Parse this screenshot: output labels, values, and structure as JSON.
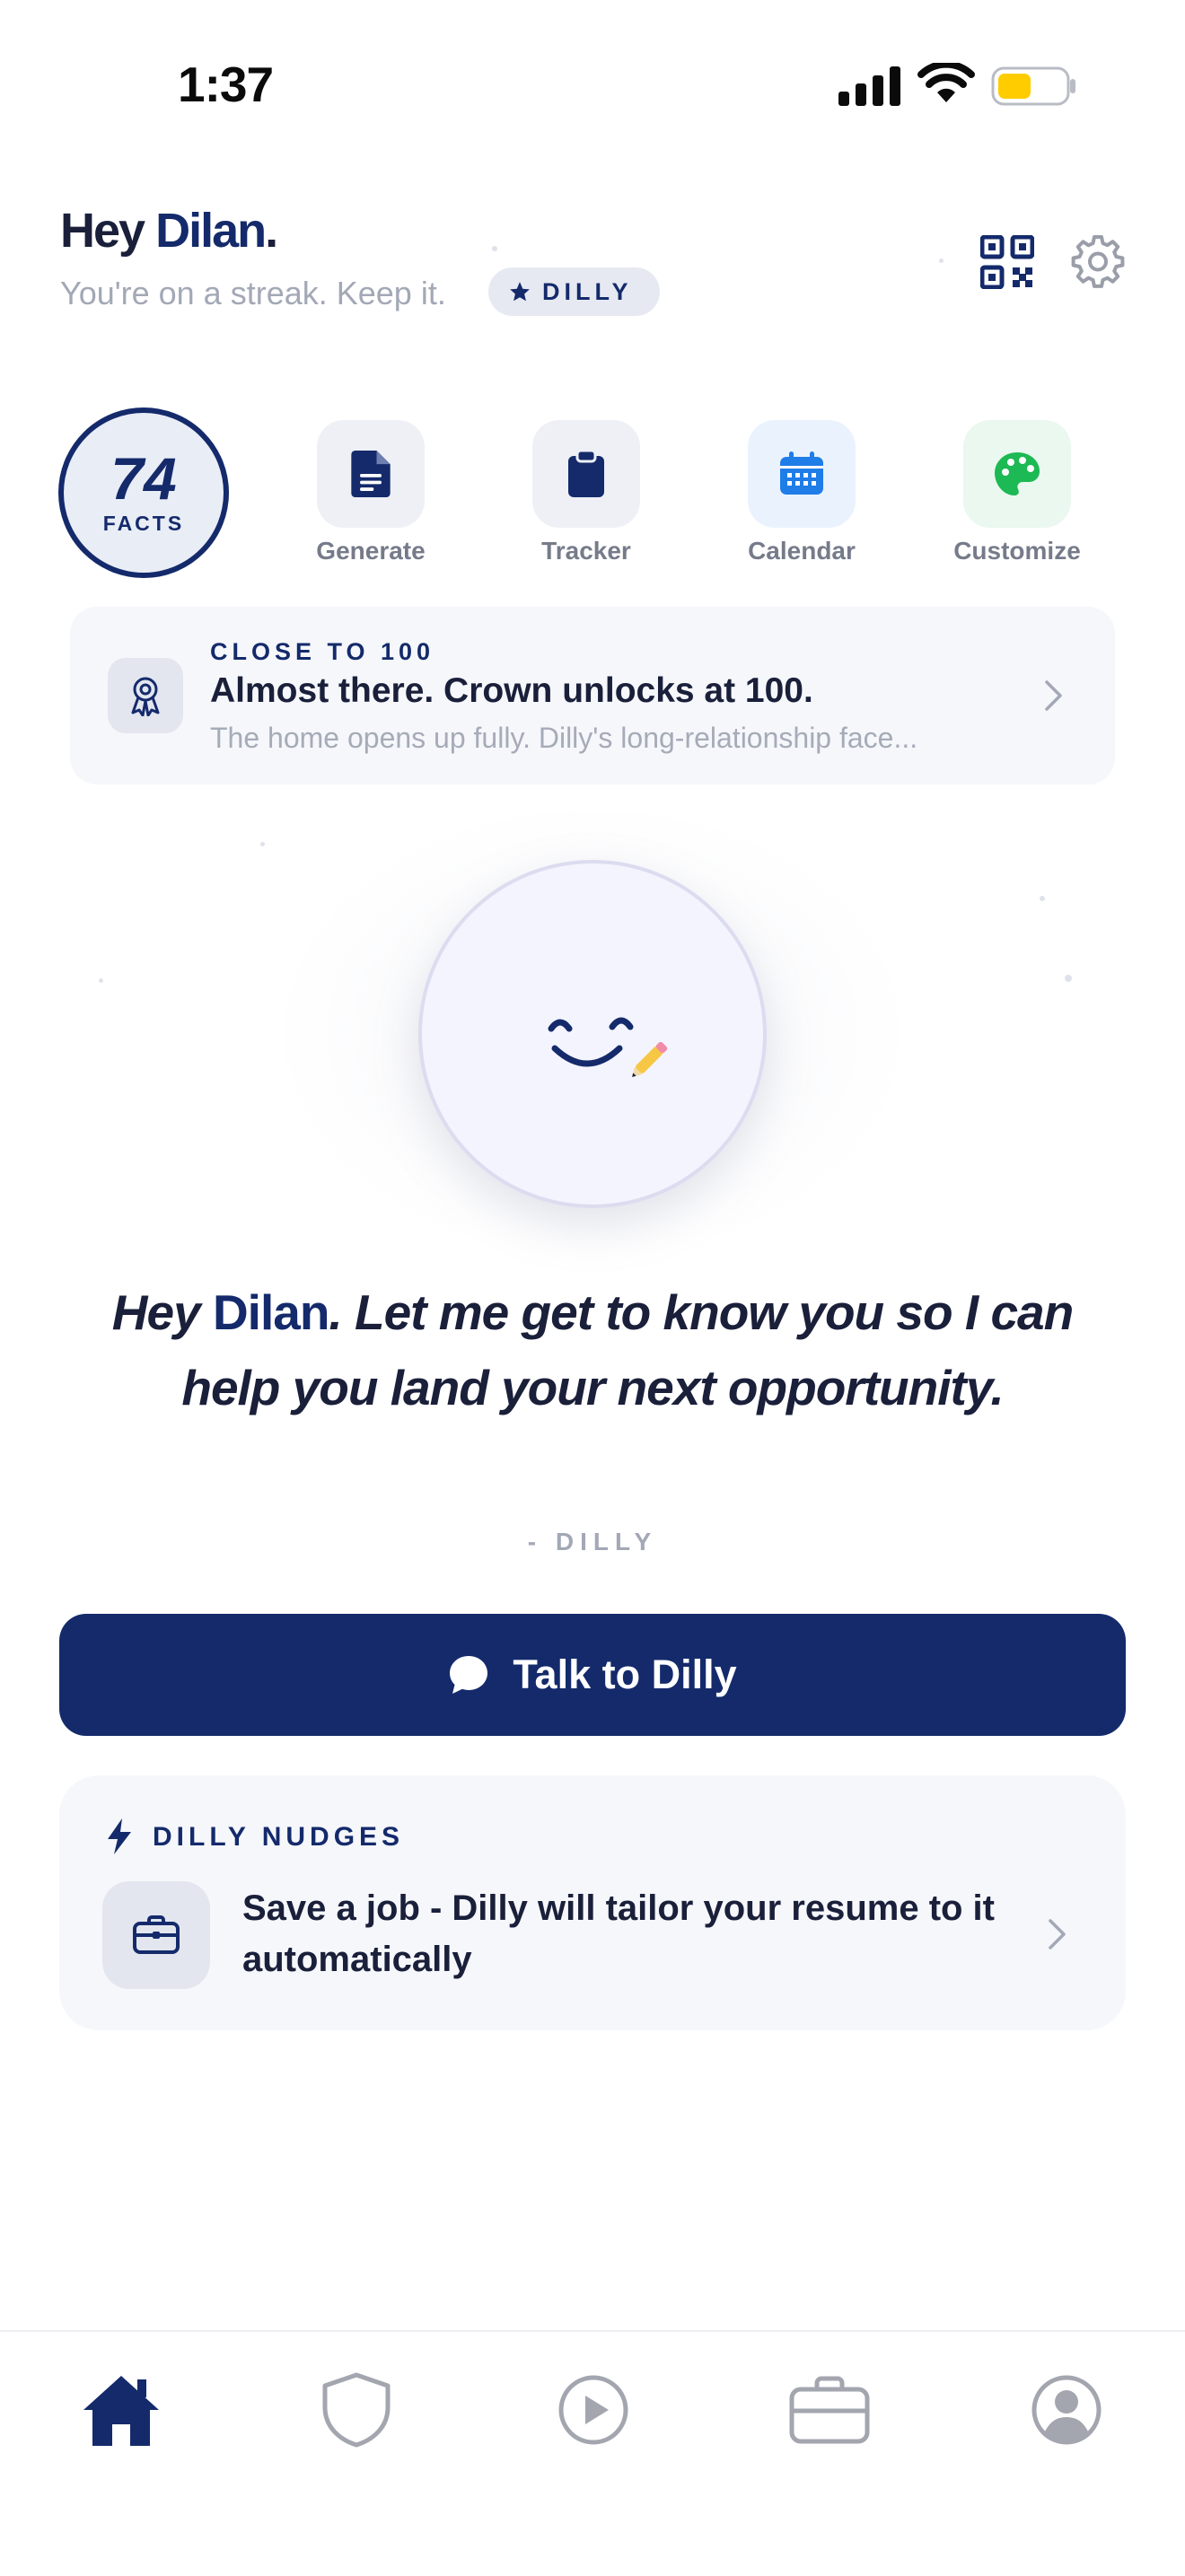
{
  "status_bar": {
    "time": "1:37"
  },
  "header": {
    "greeting_prefix": "Hey ",
    "greeting_name": "Dilan",
    "greeting_suffix": ".",
    "subtitle": "You're on a streak. Keep it.",
    "badge": "DILLY",
    "icons": [
      "qr-code-icon",
      "gear-icon"
    ]
  },
  "facts": {
    "count": "74",
    "label": "FACTS"
  },
  "quick_actions": [
    {
      "label": "Generate",
      "icon": "document-icon",
      "color": "#142a6b",
      "bg": "#eef0f6"
    },
    {
      "label": "Tracker",
      "icon": "clipboard-icon",
      "color": "#142a6b",
      "bg": "#eef0f6"
    },
    {
      "label": "Calendar",
      "icon": "calendar-icon",
      "color": "#1f7de8",
      "bg": "#eaf3fd"
    },
    {
      "label": "Customize",
      "icon": "palette-icon",
      "color": "#1db954",
      "bg": "#eaf8ef"
    }
  ],
  "milestone": {
    "kicker": "CLOSE TO 100",
    "title": "Almost there. Crown unlocks at 100.",
    "description": "The home opens up fully. Dilly's long-relationship face..."
  },
  "quote": {
    "prefix": "Hey ",
    "name": "Dilan",
    "rest": ". Let me get to know you so I can help you land your next opportunity.",
    "signature": "- DILLY"
  },
  "cta": {
    "label": "Talk to Dilly"
  },
  "nudges": {
    "kicker": "DILLY NUDGES",
    "text": "Save a job - Dilly will tailor your resume to it automatically"
  },
  "tab_bar": [
    "home-icon",
    "shield-icon",
    "play-icon",
    "briefcase-icon",
    "profile-icon"
  ],
  "colors": {
    "primary": "#142a6b",
    "muted": "#a3a8b6",
    "card": "#f5f7fb"
  }
}
